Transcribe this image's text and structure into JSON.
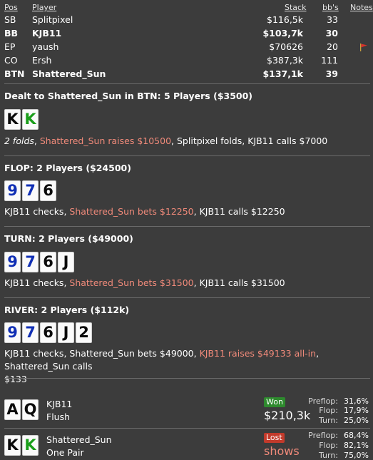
{
  "table": {
    "headers": {
      "pos": "Pos",
      "player": "Player",
      "stack": "Stack",
      "bbs": "bb's",
      "notes": "Notes"
    },
    "players": [
      {
        "pos": "SB",
        "name": "Splitpixel",
        "stack": "$116,5k",
        "bbs": "33",
        "bold": false,
        "flag": false
      },
      {
        "pos": "BB",
        "name": "KJB11",
        "stack": "$103,7k",
        "bbs": "30",
        "bold": true,
        "flag": false
      },
      {
        "pos": "EP",
        "name": "yaush",
        "stack": "$70626",
        "bbs": "20",
        "bold": false,
        "flag": true
      },
      {
        "pos": "CO",
        "name": "Ersh",
        "stack": "$387,3k",
        "bbs": "111",
        "bold": false,
        "flag": false
      },
      {
        "pos": "BTN",
        "name": "Shattered_Sun",
        "stack": "$137,1k",
        "bbs": "39",
        "bold": true,
        "flag": false
      }
    ]
  },
  "preflop": {
    "title": "Dealt to Shattered_Sun in BTN: 5 Players ($3500)",
    "cards": [
      {
        "rank": "K",
        "suit": "black"
      },
      {
        "rank": "K",
        "suit": "green"
      }
    ],
    "actions": {
      "a": "2 folds",
      "sep1": ", ",
      "b": "Shattered_Sun raises $10500",
      "sep2": ", ",
      "c": "Splitpixel folds, KJB11 calls $7000"
    }
  },
  "flop": {
    "title": "FLOP: 2 Players ($24500)",
    "cards": [
      {
        "rank": "9",
        "suit": "blue"
      },
      {
        "rank": "7",
        "suit": "blue"
      },
      {
        "rank": "6",
        "suit": "black"
      }
    ],
    "actions": {
      "a": "KJB11 checks, ",
      "b": "Shattered_Sun bets $12250",
      "c": ", KJB11 calls $12250"
    }
  },
  "turn": {
    "title": "TURN: 2 Players ($49000)",
    "cards": [
      {
        "rank": "9",
        "suit": "blue"
      },
      {
        "rank": "7",
        "suit": "blue"
      },
      {
        "rank": "6",
        "suit": "black"
      },
      {
        "rank": "J",
        "suit": "black"
      }
    ],
    "actions": {
      "a": "KJB11 checks, ",
      "b": "Shattered_Sun bets $31500",
      "c": ", KJB11 calls $31500"
    }
  },
  "river": {
    "title": "RIVER: 2 Players ($112k)",
    "cards": [
      {
        "rank": "9",
        "suit": "blue"
      },
      {
        "rank": "7",
        "suit": "blue"
      },
      {
        "rank": "6",
        "suit": "black"
      },
      {
        "rank": "J",
        "suit": "black"
      },
      {
        "rank": "2",
        "suit": "black"
      }
    ],
    "actions": {
      "a": "KJB11 checks, Shattered_Sun bets $49000, ",
      "b": "KJB11 raises $49133 all-in",
      "c": ", Shattered_Sun calls",
      "d": "$133"
    }
  },
  "results": [
    {
      "name": "KJB11",
      "hand": "Flush",
      "badge": "Won",
      "amount": "$210,3k",
      "cards": [
        {
          "rank": "A",
          "suit": "black"
        },
        {
          "rank": "Q",
          "suit": "black"
        }
      ],
      "stats": [
        {
          "label": "Preflop:",
          "value": "31,6%"
        },
        {
          "label": "Flop:",
          "value": "17,9%"
        },
        {
          "label": "Turn:",
          "value": "25,0%"
        }
      ]
    },
    {
      "name": "Shattered_Sun",
      "hand": "One Pair",
      "badge": "Lost",
      "amount": "shows",
      "cards": [
        {
          "rank": "K",
          "suit": "black"
        },
        {
          "rank": "K",
          "suit": "green"
        }
      ],
      "stats": [
        {
          "label": "Preflop:",
          "value": "68,4%"
        },
        {
          "label": "Flop:",
          "value": "82,1%"
        },
        {
          "label": "Turn:",
          "value": "75,0%"
        }
      ]
    }
  ],
  "colors": {
    "background": "#3c3c3c",
    "highlight": "#f08a7a",
    "won": "#2e8a2e",
    "lost": "#c23a2b",
    "card_blue": "#102fb5",
    "card_green": "#1a9e1a"
  }
}
